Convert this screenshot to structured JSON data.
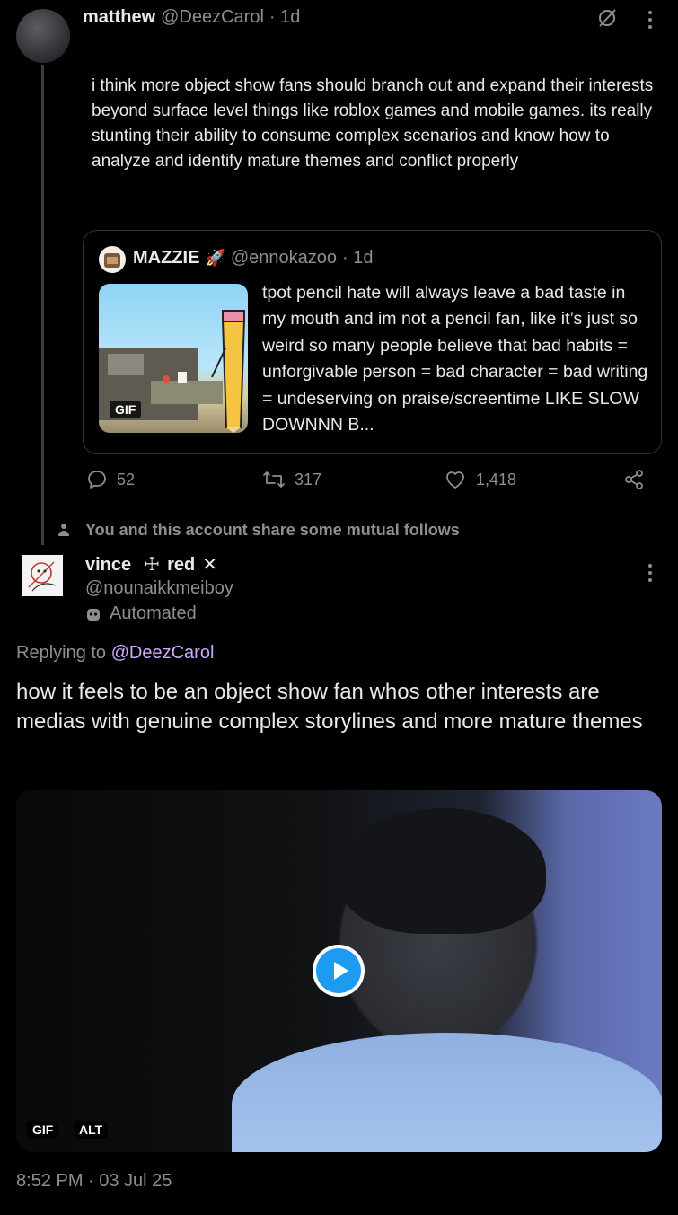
{
  "tweet": {
    "author_name": "matthew",
    "author_handle": "@DeezCarol",
    "time": "· 1d",
    "text": "i think more object show fans should branch out and expand their interests beyond surface level things like roblox games and mobile games. its really stunting their ability to consume complex scenarios and know how to analyze and identify mature themes and conflict properly",
    "quote": {
      "author_name": "MAZZIE",
      "author_emoji": "🚀",
      "author_handle": "@ennokazoo",
      "time": "· 1d",
      "media_badge": "GIF",
      "text": "tpot pencil hate will always leave a bad taste in my mouth and im not a pencil fan, like it’s just so weird so many people believe that bad habits = unforgivable person = bad character = bad writing = undeserving on praise/screentime LIKE SLOW DOWNNN B..."
    },
    "stats": {
      "replies": "52",
      "reposts": "317",
      "likes": "1,418"
    }
  },
  "mutual_note": "You and this account share some mutual follows",
  "reply": {
    "author_name": "vince",
    "name_cross": "☩",
    "name_red": "red",
    "name_symbol": "✕",
    "author_handle": "@nounaikkmeiboy",
    "automated_label": "Automated",
    "replying_to_prefix": "Replying to",
    "replying_to_handle": "@DeezCarol",
    "text": "how it feels to be an object show fan whos other interests are medias with genuine complex storylines and more mature themes",
    "media_badges": {
      "gif": "GIF",
      "alt": "ALT"
    },
    "timestamp": "8:52 PM · 03 Jul 25"
  },
  "colors": {
    "accent": "#1d9bf0",
    "mention": "#c9a8ff",
    "muted": "#8b8f94",
    "background": "#000000"
  }
}
